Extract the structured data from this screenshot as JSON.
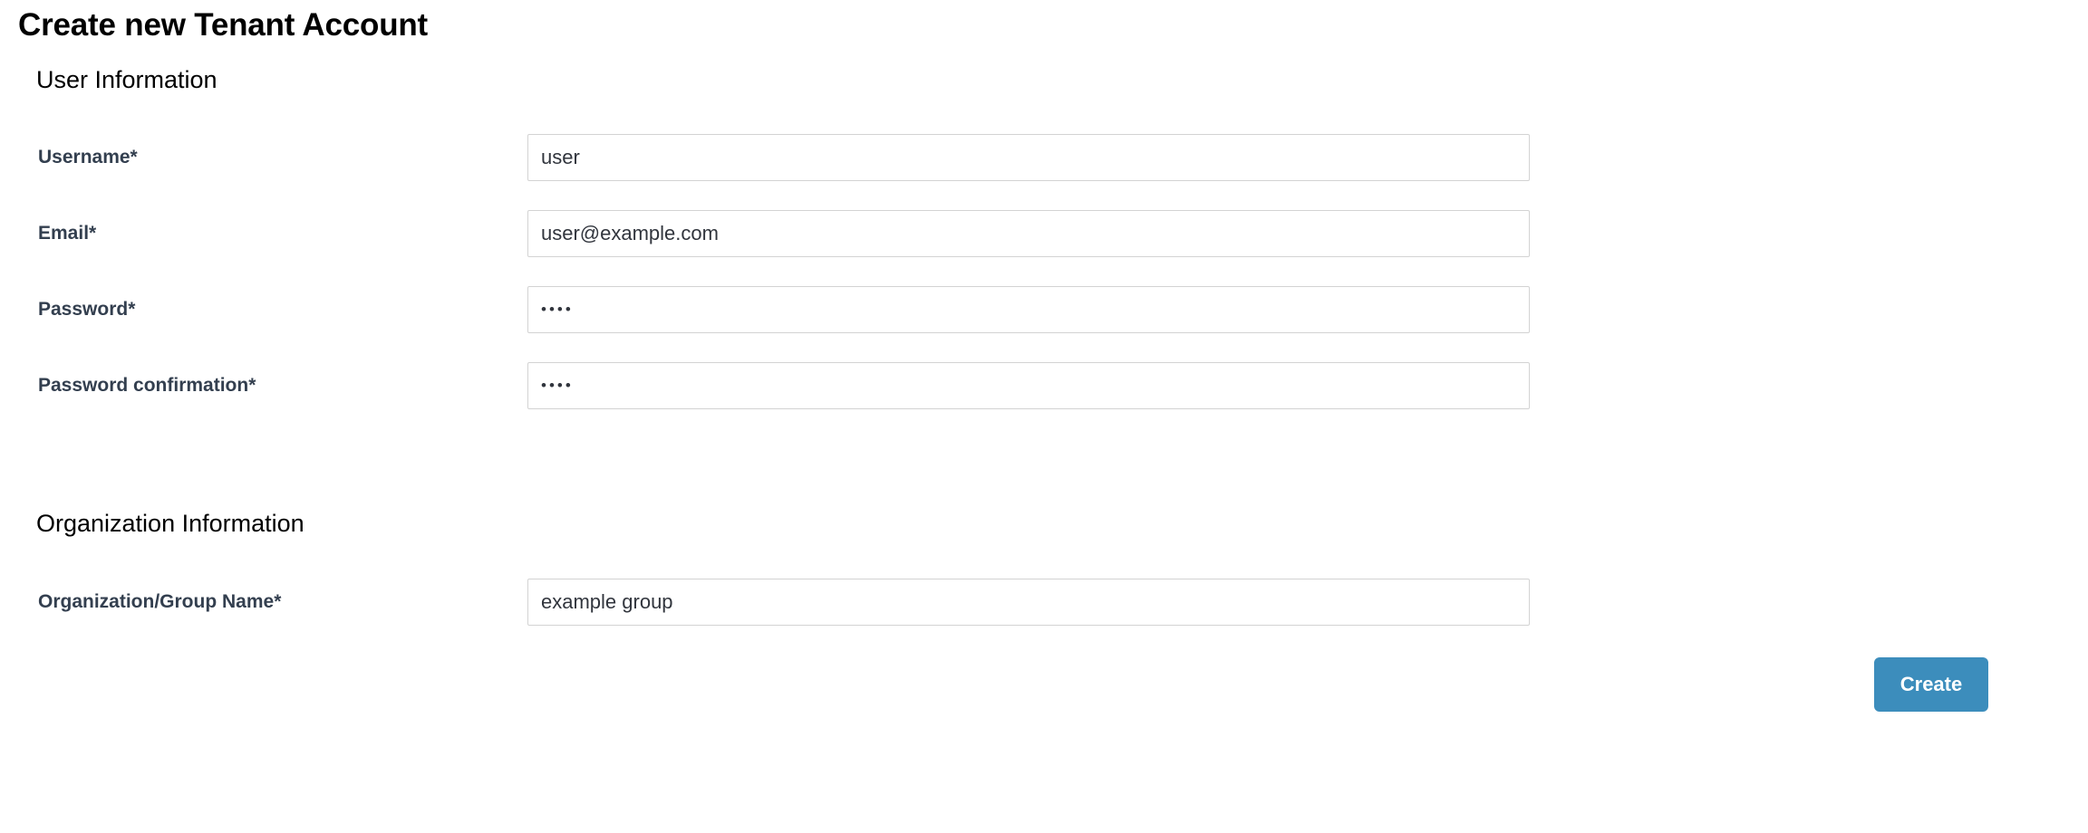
{
  "page": {
    "title": "Create new Tenant Account"
  },
  "sections": {
    "user": {
      "heading": "User Information",
      "fields": {
        "username": {
          "label": "Username*",
          "value": "user",
          "placeholder": ""
        },
        "email": {
          "label": "Email*",
          "value": "user@example.com",
          "placeholder": ""
        },
        "password": {
          "label": "Password*",
          "value": "••••",
          "placeholder": ""
        },
        "password_confirmation": {
          "label": "Password confirmation*",
          "value": "••••",
          "placeholder": ""
        }
      }
    },
    "organization": {
      "heading": "Organization Information",
      "fields": {
        "group_name": {
          "label": "Organization/Group Name*",
          "value": "example group",
          "placeholder": ""
        }
      }
    }
  },
  "actions": {
    "create_label": "Create"
  },
  "colors": {
    "button_background": "#3c8dbc",
    "button_text": "#ffffff",
    "label_text": "#333f4f",
    "input_border": "#d3d3d3",
    "input_text": "#31353d",
    "page_background": "#ffffff",
    "title_text": "#000000"
  }
}
